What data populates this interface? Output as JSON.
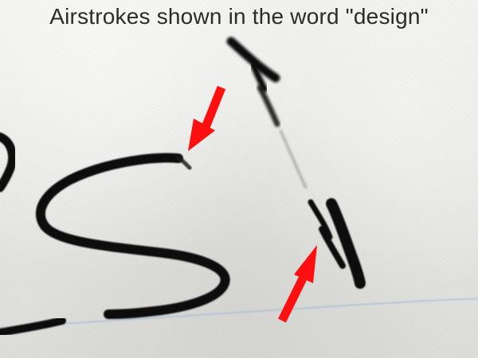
{
  "caption": "Airstrokes shown in the word \"design\"",
  "colors": {
    "ink": "#0d0d0d",
    "arrow": "#ff1010",
    "ruled_line": "#9fb8d6",
    "paper": "#e9e9e7"
  },
  "figure": {
    "subject": "handwriting",
    "annotation_icons": [
      "arrow-icon",
      "arrow-icon"
    ]
  }
}
